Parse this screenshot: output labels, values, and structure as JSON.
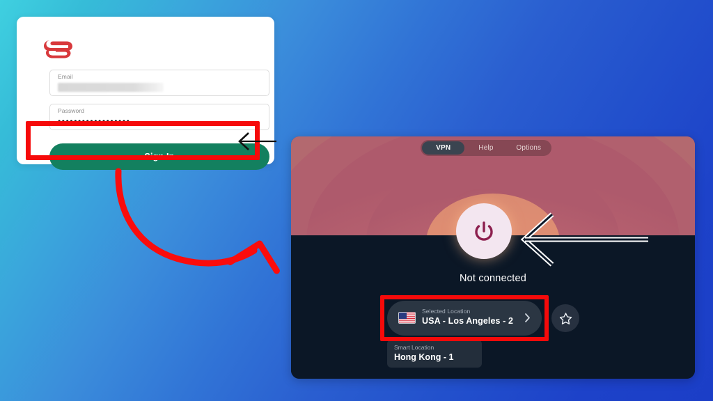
{
  "background": {
    "gradient_from": "#3fd0e0",
    "gradient_to": "#1b3ec7"
  },
  "login_card": {
    "brand": "expressvpn-logo",
    "brand_color": "#d8393c",
    "email_field": {
      "label": "Email",
      "value": "",
      "redacted": true
    },
    "password_field": {
      "label": "Password",
      "value": "••••••••••••••••••"
    },
    "sign_in_button": {
      "label": "Sign In",
      "color": "#13805f"
    },
    "highlight_color": "#f60a0a"
  },
  "annotations": {
    "flow_arrow_color": "#fb0c0c",
    "sign_in_pointer": "left-arrow-icon",
    "vpn_pointer": "left-arrow-icon"
  },
  "vpn_window": {
    "tabs": [
      {
        "label": "VPN",
        "active": true
      },
      {
        "label": "Help",
        "active": false
      },
      {
        "label": "Options",
        "active": false
      }
    ],
    "power_button": {
      "icon": "power-icon",
      "icon_color": "#8c1f4e",
      "background": "#f3e6f0"
    },
    "status": "Not connected",
    "selected_location": {
      "caption": "Selected Location",
      "name": "USA - Los Angeles - 2",
      "flag": "us-flag-icon",
      "chevron": "chevron-right-icon"
    },
    "favorite_button": {
      "icon": "star-icon"
    },
    "smart_location": {
      "caption": "Smart Location",
      "name": "Hong Kong - 1"
    },
    "highlight_color": "#f60a0a",
    "hero_colors": {
      "outer": "#b96f75",
      "mid": "#b45b6e",
      "glow": "#f0a468"
    },
    "body_color": "#0b1726"
  }
}
